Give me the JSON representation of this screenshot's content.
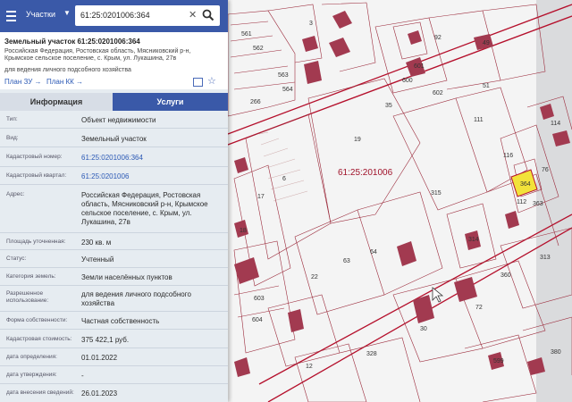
{
  "search": {
    "type_label": "Участки",
    "query": "61:25:0201006:364"
  },
  "parcel": {
    "title": "Земельный участок 61:25:0201006:364",
    "address": "Российская Федерация, Ростовская область, Мясниковский р-н, Крымское сельское поселение, с. Крым, ул. Лукашина, 27в",
    "purpose": "для ведения личного подсобного хозяйства",
    "plan_zu": "План ЗУ →",
    "plan_kk": "План КК →"
  },
  "tabs": {
    "info": "Информация",
    "services": "Услуги"
  },
  "rows": [
    {
      "label": "Тип:",
      "value": "Объект недвижимости"
    },
    {
      "label": "Вид:",
      "value": "Земельный участок"
    },
    {
      "label": "Кадастровый номер:",
      "value": "61:25:0201006:364"
    },
    {
      "label": "Кадастровый квартал:",
      "value": "61:25:0201006"
    },
    {
      "label": "Адрес:",
      "value": "Российская Федерация, Ростовская область, Мясниковский р-н, Крымское сельское поселение, с. Крым, ул. Лукашина, 27в"
    },
    {
      "label": "Площадь уточненная:",
      "value": "230 кв. м"
    },
    {
      "label": "Статус:",
      "value": "Учтенный"
    },
    {
      "label": "Категория земель:",
      "value": "Земли населённых пунктов"
    },
    {
      "label": "Разрешенное использование:",
      "value": "для ведения личного подсобного хозяйства"
    },
    {
      "label": "Форма собственности:",
      "value": "Частная собственность"
    },
    {
      "label": "Кадастровая стоимость:",
      "value": "375 422,1 руб."
    },
    {
      "label": "дата определения:",
      "value": "01.01.2022"
    },
    {
      "label": "дата утверждения:",
      "value": "-"
    },
    {
      "label": "дата внесения сведений:",
      "value": "26.01.2023"
    }
  ],
  "map": {
    "quarter_label": "61:25:201006",
    "parcel_numbers": [
      "3",
      "561",
      "562",
      "563",
      "564",
      "266",
      "92",
      "49",
      "601",
      "600",
      "602",
      "35",
      "51",
      "114",
      "19",
      "111",
      "116",
      "364",
      "363",
      "112",
      "76",
      "17",
      "6",
      "315",
      "18",
      "64",
      "63",
      "22",
      "314",
      "313",
      "360",
      "603",
      "604",
      "30",
      "72",
      "328",
      "12",
      "599",
      "380"
    ]
  },
  "colors": {
    "accent": "#3a59a8",
    "selected_parcel": "#f2e23a",
    "building": "#a23a50",
    "boundary": "#b5102c",
    "map_bg": "#f4f4f4"
  }
}
